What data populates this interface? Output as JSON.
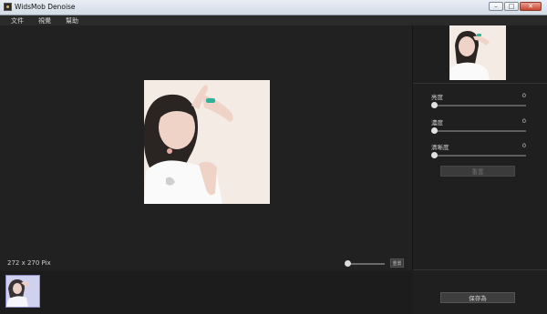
{
  "window": {
    "title": "WidsMob Denoise",
    "minimize": "–",
    "maximize": "□",
    "close": "✕"
  },
  "menu": [
    "文件",
    "視覺",
    "幫助"
  ],
  "canvas": {
    "image_size": "272 x 270 Pix",
    "zoom_button": "重置"
  },
  "panel": {
    "sliders": [
      {
        "label": "亮度",
        "value": "0"
      },
      {
        "label": "濃度",
        "value": "0"
      },
      {
        "label": "清晰度",
        "value": "0"
      }
    ],
    "reset_label": "重置",
    "save_label": "保存為"
  },
  "colors": {
    "background": "#1e1e1e",
    "panel": "#1f1f1f",
    "photo_bg": "#f1e8e1",
    "thumb_bg": "#cdd0ea"
  },
  "icons": [
    "app-icon",
    "minimize-icon",
    "maximize-icon",
    "close-icon"
  ]
}
